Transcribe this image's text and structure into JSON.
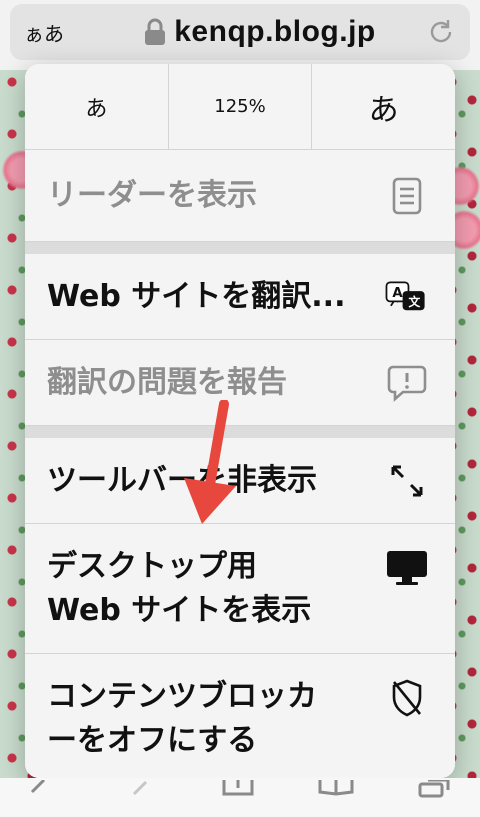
{
  "address_bar": {
    "aa_label": "ぁあ",
    "url": "kenqp.blog.jp"
  },
  "menu": {
    "zoom": {
      "smaller_label": "あ",
      "percent": "125%",
      "larger_label": "あ"
    },
    "items": [
      {
        "label": "リーダーを表示",
        "icon": "reader-icon",
        "enabled": false
      },
      {
        "label": "Web サイトを翻訳...",
        "icon": "translate-icon",
        "enabled": true
      },
      {
        "label": "翻訳の問題を報告",
        "icon": "report-issue-icon",
        "enabled": false
      },
      {
        "label": "ツールバーを非表示",
        "icon": "expand-arrows-icon",
        "enabled": true
      },
      {
        "label": "デスクトップ用\nWeb サイトを表示",
        "icon": "desktop-icon",
        "enabled": true
      },
      {
        "label": "コンテンツブロッカ\nーをオフにする",
        "icon": "shield-off-icon",
        "enabled": true
      }
    ]
  },
  "colors": {
    "arrow": "#e8473d",
    "menu_bg": "#f4f4f4",
    "disabled_text": "#8e8e8e"
  }
}
